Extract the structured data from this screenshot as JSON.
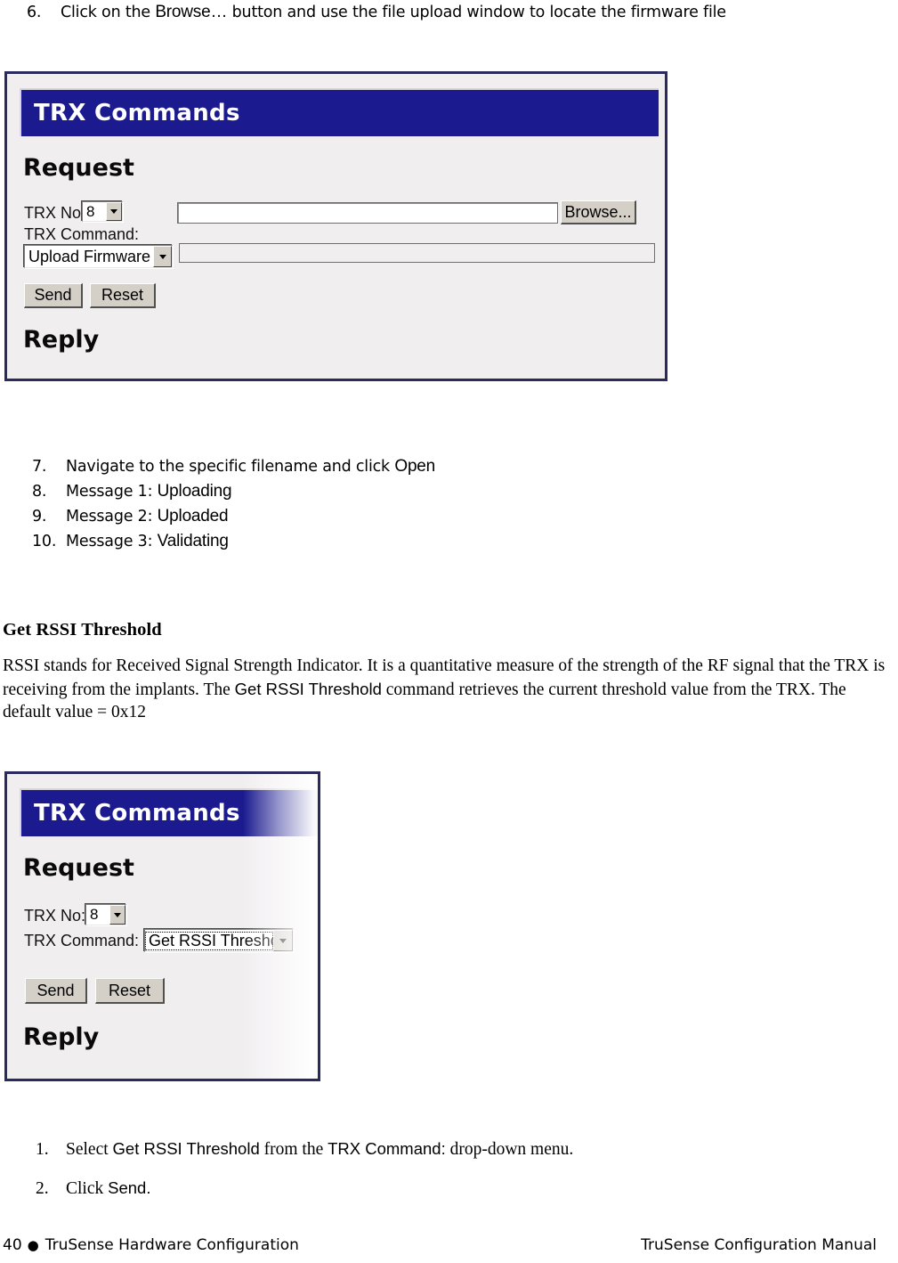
{
  "page": {
    "step6": {
      "num": "6.",
      "pre": "Click on the ",
      "term": "Browse…",
      "post": " button and use the file upload window to locate the firmware file"
    }
  },
  "steps_upload": [
    {
      "num": "7.",
      "pre": "Navigate to the specific filename and click ",
      "term": "Open",
      "post": ""
    },
    {
      "num": "8.",
      "pre": "Message 1: ",
      "term": "Uploading",
      "post": ""
    },
    {
      "num": "9.",
      "pre": "Message 2: ",
      "term": "Uploaded",
      "post": ""
    },
    {
      "num": "10.",
      "pre": "Message 3: ",
      "term": "Validating",
      "post": ""
    }
  ],
  "section": {
    "heading": "Get RSSI Threshold",
    "paragraph_part1": "RSSI stands for Received Signal Strength Indicator. It is a quantitative measure of the strength of the RF signal that the TRX is receiving from the implants.  The ",
    "paragraph_term": "Get RSSI Threshold",
    "paragraph_part2": " command retrieves the current threshold value from the TRX. The default value = 0x12"
  },
  "figure_upload": {
    "title": "TRX Commands",
    "request_heading": "Request",
    "reply_heading": "Reply",
    "trx_no_label": "TRX No:",
    "trx_no_value": "8",
    "trx_command_label": "TRX Command:",
    "trx_command_value": "Upload Firmware",
    "file_path_value": "",
    "browse_label": "Browse...",
    "send_label": "Send",
    "reset_label": "Reset",
    "title_bar_color": "#1b1b8f",
    "panel_color": "#f1eef0",
    "border_color": "#2a2a5e"
  },
  "figure_rssi": {
    "title": "TRX Commands",
    "request_heading": "Request",
    "reply_heading": "Reply",
    "trx_no_label": "TRX No:",
    "trx_no_value": "8",
    "trx_command_label": "TRX Command:",
    "trx_command_value": "Get RSSI Threshold",
    "send_label": "Send",
    "reset_label": "Reset",
    "title_bar_color": "#1b1b8f",
    "panel_color": "#f1eef0",
    "border_color": "#3a3a60"
  },
  "steps_rssi": [
    {
      "num": "1.",
      "pre": "Select ",
      "term": "Get RSSI Threshold",
      "mid": " from the ",
      "term2": "TRX Command:",
      "post": " drop-down menu."
    },
    {
      "num": "2.",
      "pre": "Click ",
      "term": "Send.",
      "mid": "",
      "term2": "",
      "post": ""
    }
  ],
  "footer": {
    "page_number": "40",
    "bullet": "●",
    "left_text": "TruSense Hardware Configuration",
    "right_text": "TruSense Configuration Manual"
  }
}
